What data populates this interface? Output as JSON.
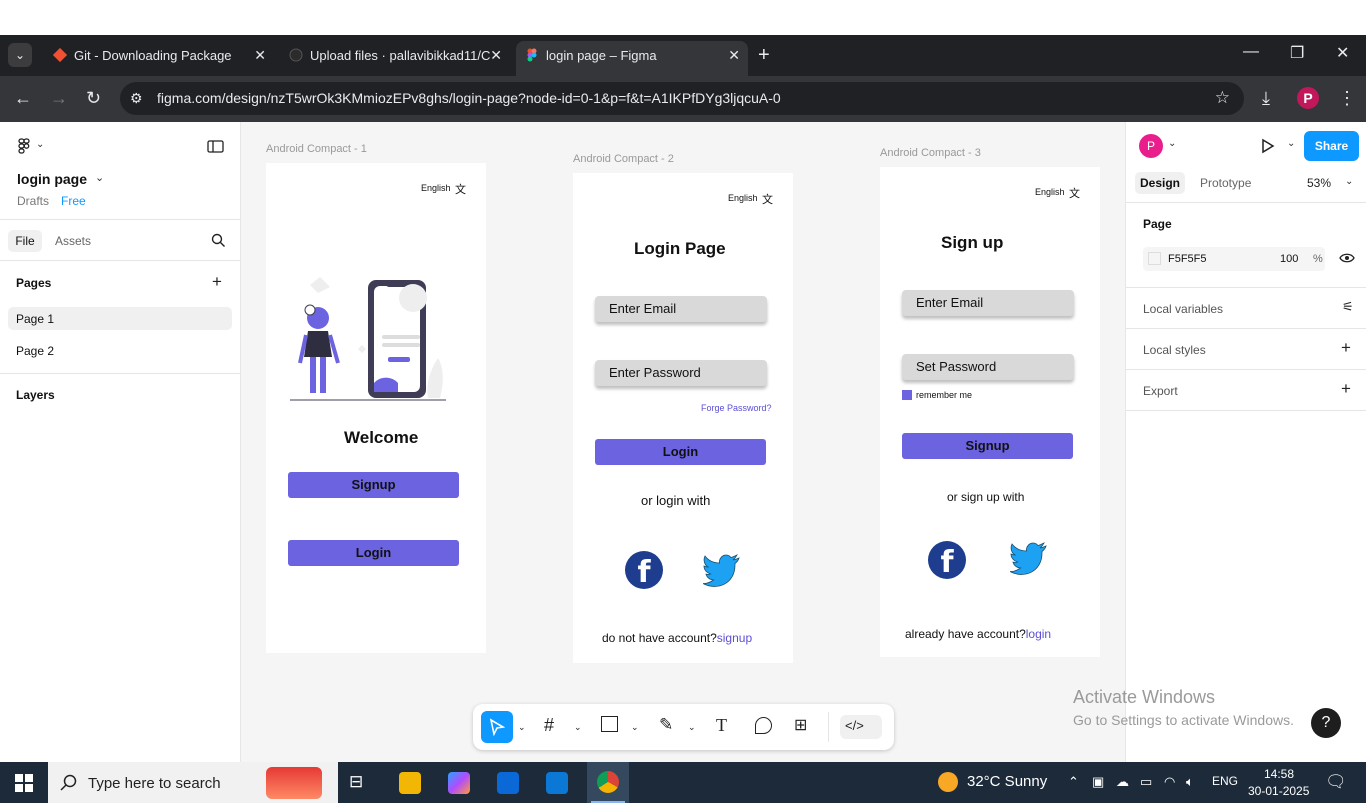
{
  "browser": {
    "tabs": [
      {
        "title": "Git - Downloading Package"
      },
      {
        "title": "Upload files · pallavibikkad11/C"
      },
      {
        "title": "login page – Figma"
      }
    ],
    "url": "figma.com/design/nzT5wrOk3KMmiozEPv8ghs/login-page?node-id=0-1&p=f&t=A1IKPfDYg3ljqcuA-0",
    "profile_letter": "P"
  },
  "left_panel": {
    "file_name": "login page",
    "drafts": "Drafts",
    "plan": "Free",
    "tab_file": "File",
    "tab_assets": "Assets",
    "pages_heading": "Pages",
    "pages": [
      "Page 1",
      "Page 2"
    ],
    "layers_heading": "Layers"
  },
  "canvas": {
    "frame1": {
      "label": "Android Compact - 1",
      "language": "English",
      "welcome": "Welcome",
      "signup_btn": "Signup",
      "login_btn": "Login"
    },
    "frame2": {
      "label": "Android Compact - 2",
      "language": "English",
      "title": "Login Page",
      "email_placeholder": "Enter Email",
      "password_placeholder": "Enter Password",
      "forgot": "Forge Password?",
      "login_btn": "Login",
      "or_text": "or login with",
      "footer_text": "do not have account?",
      "footer_link": "signup"
    },
    "frame3": {
      "label": "Android Compact - 3",
      "language": "English",
      "title": "Sign up",
      "email_placeholder": "Enter Email",
      "password_placeholder": "Set Password",
      "remember": "remember me",
      "signup_btn": "Signup",
      "or_text": "or sign up with",
      "footer_text": "already have account?",
      "footer_link": "login"
    }
  },
  "right_panel": {
    "avatar_letter": "P",
    "share": "Share",
    "tab_design": "Design",
    "tab_prototype": "Prototype",
    "zoom": "53%",
    "page_heading": "Page",
    "page_color": "F5F5F5",
    "opacity": "100",
    "opacity_unit": "%",
    "local_variables": "Local variables",
    "local_styles": "Local styles",
    "export": "Export"
  },
  "watermark": {
    "line1": "Activate Windows",
    "line2": "Go to Settings to activate Windows."
  },
  "taskbar": {
    "search_placeholder": "Type here to search",
    "weather": "32°C  Sunny",
    "lang": "ENG",
    "time": "14:58",
    "date": "30-01-2025"
  },
  "colors": {
    "accent": "#6c63e0",
    "figma_blue": "#0d99ff",
    "link": "#5b4fd6",
    "canvas_bg": "#f5f5f5"
  }
}
